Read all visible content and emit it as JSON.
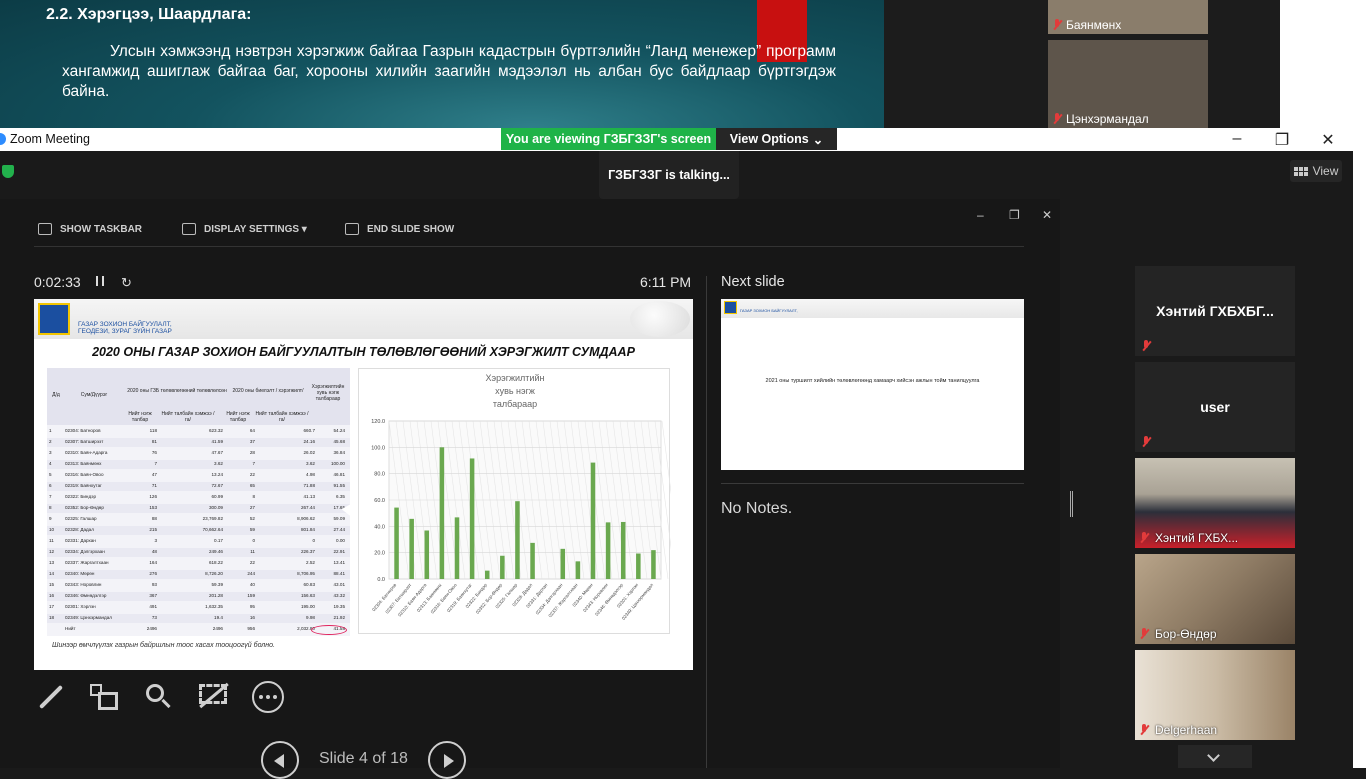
{
  "shared_slide_top": {
    "heading": "2.2. Хэрэгцээ, Шаардлага:",
    "paragraph": "Улсын хэмжээнд нэвтрэн хэрэгжиж байгаа Газрын кадастрын бүртгэлийн “Ланд менежер” программ хангамжид ашиглаж байгаа баг, хорооны хилийн заагийн мэдээлэл нь албан бус байдлаар бүртгэгдэж байна."
  },
  "top_thumbnails": [
    {
      "name": "Баянмөнх"
    },
    {
      "name": "Цэнхэрмандал"
    }
  ],
  "window": {
    "title": "Zoom Meeting",
    "viewing_banner": "You are viewing ГЗБГЗЗГ's screen",
    "view_options": "View Options",
    "minimize": "–",
    "restore": "❐",
    "close": "✕"
  },
  "talking_indicator": "ГЗБГЗЗГ is talking...",
  "view_button": "View",
  "presenter": {
    "toolbar": {
      "show_taskbar": "SHOW TASKBAR",
      "display_settings": "DISPLAY SETTINGS ▾",
      "end_slide_show": "END SLIDE SHOW"
    },
    "window_controls": {
      "minimize": "–",
      "restore": "❐",
      "close": "✕"
    },
    "timer": "0:02:33",
    "clock": "6:11 PM",
    "next_slide_label": "Next slide",
    "notes": "No Notes.",
    "slide_counter": "Slide 4 of 18",
    "current_slide": {
      "org_line1": "ГАЗАР ЗОХИОН БАЙГУУЛАЛТ,",
      "org_line2": "ГЕОДЕЗИ, ЗУРАГ ЗҮЙН ГАЗАР",
      "title": "2020 ОНЫ ГАЗАР ЗОХИОН БАЙГУУЛАЛТЫН ТӨЛӨВЛӨГӨӨНИЙ ХЭРЭГЖИЛТ СУМДААР",
      "footnote": "Шинээр өмчлүүлэх газрын байршлын тоос хасах тооцоогүй болно.",
      "table_headers": {
        "num": "Д/д",
        "name": "Сум/Дүүрэг",
        "plan": "2020 оны ГЗБ төлөвлөгөөний төлөвлөлсөн",
        "actual": "2020 оны биелэлт / хэрэгжилт/",
        "percent": "Хэрэгжилтийн хувь нэгж талбараар",
        "plan_count": "Нийт нэгж талбар",
        "plan_area": "Нийт талбайн хэмжээ /га/",
        "actual_count": "Нийт нэгж талбар",
        "actual_area": "Нийт талбайн хэмжээ /га/"
      },
      "table_rows": [
        [
          "1",
          "02304: Батноров",
          "118",
          "623.32",
          "64",
          "660.7",
          "54.24"
        ],
        [
          "2",
          "02307: Батширээт",
          "81",
          "41.59",
          "37",
          "24.16",
          "45.68"
        ],
        [
          "3",
          "02310: Баян-Адарга",
          "76",
          "47.67",
          "28",
          "26.02",
          "36.84"
        ],
        [
          "4",
          "02313: Баянмөнх",
          "7",
          "3.62",
          "7",
          "3.62",
          "100.00"
        ],
        [
          "5",
          "02316: Баян-Овоо",
          "47",
          "13.24",
          "22",
          "4.98",
          "46.81"
        ],
        [
          "6",
          "02319: Баянхутаг",
          "71",
          "72.67",
          "65",
          "71.88",
          "91.55"
        ],
        [
          "7",
          "02322: Биндэр",
          "126",
          "60.99",
          "8",
          "41.13",
          "6.35"
        ],
        [
          "8",
          "02352: Бор-Өндөр",
          "153",
          "300.09",
          "27",
          "267.44",
          "17.65"
        ],
        [
          "9",
          "02325: Галшар",
          "88",
          "23,769.82",
          "52",
          "8,906.62",
          "59.09"
        ],
        [
          "10",
          "02328: Дадал",
          "215",
          "70,662.64",
          "59",
          "801.84",
          "27.44"
        ],
        [
          "11",
          "02331: Дархан",
          "3",
          "0.17",
          "0",
          "0",
          "0.00"
        ],
        [
          "12",
          "02334: Дэлгэрхаан",
          "48",
          "249.46",
          "11",
          "226.37",
          "22.91"
        ],
        [
          "13",
          "02337: Жаргалтхаан",
          "164",
          "618.22",
          "22",
          "2.52",
          "13.41"
        ],
        [
          "14",
          "02340: Мөрөн",
          "276",
          "8,726.20",
          "244",
          "8,706.95",
          "88.41"
        ],
        [
          "15",
          "02343: Норовлин",
          "93",
          "59.39",
          "40",
          "60.83",
          "43.01"
        ],
        [
          "16",
          "02346: Өмнөдэлгэр",
          "367",
          "201.28",
          "159",
          "156.63",
          "43.32"
        ],
        [
          "17",
          "02301: Хэрлэн",
          "491",
          "1,632.35",
          "95",
          "195.00",
          "19.35"
        ],
        [
          "18",
          "02349: Цэнхэрмандал",
          "73",
          "19.4",
          "16",
          "9.98",
          "21.92"
        ],
        [
          "",
          "Нийт",
          "2496",
          "2496",
          "956",
          "2,032.80",
          "41.58"
        ]
      ]
    },
    "next_slide": {
      "text": "2021 оны туршилт хийлийн төлөвлөгөөнд хамаарч хийсэн ажлын тойм танилцуулга"
    }
  },
  "chart_data": {
    "type": "bar",
    "title": "Хэрэгжилтийн хувь нэгж талбараар",
    "categories": [
      "02304: Батноров",
      "02307: Батширээт",
      "02310: Баян-Адарга",
      "02313: Баянмөнх",
      "02316: Баян-Овоо",
      "02319: Баянхутаг",
      "02322: Биндэр",
      "02352: Бор-Өндөр",
      "02325: Галшар",
      "02328: Дадал",
      "02331: Дархан",
      "02334: Дэлгэрхаан",
      "02337: Жаргалтхаан",
      "02340: Мөрөн",
      "02343: Норовлин",
      "02346: Өмнөдэлгэр",
      "02301: Хэрлэн",
      "02349: Цэнхэрмандал"
    ],
    "values": [
      54.24,
      45.68,
      36.84,
      100.0,
      46.81,
      91.55,
      6.35,
      17.65,
      59.09,
      27.44,
      0.0,
      22.91,
      13.41,
      88.41,
      43.01,
      43.32,
      19.35,
      21.92
    ],
    "ylim": [
      0,
      120
    ],
    "yticks": [
      "0.0",
      "20.0",
      "40.0",
      "60.0",
      "80.0",
      "100.0",
      "120.0"
    ],
    "grid": true,
    "bar_color": "#6aa84f"
  },
  "participants": [
    {
      "name": "Хэнтий ГХБХБГ...",
      "type": "name-tile"
    },
    {
      "name": "user",
      "type": "name-tile"
    },
    {
      "name": "Хэнтий ГХБХ...",
      "type": "video"
    },
    {
      "name": "Бор-Өндөр",
      "type": "video"
    },
    {
      "name": "Delgerhaan",
      "type": "video"
    }
  ],
  "colors": {
    "zoom_green": "#1fb348",
    "mic_muted": "#e23b3b",
    "brand_blue": "#1b4fa0"
  }
}
